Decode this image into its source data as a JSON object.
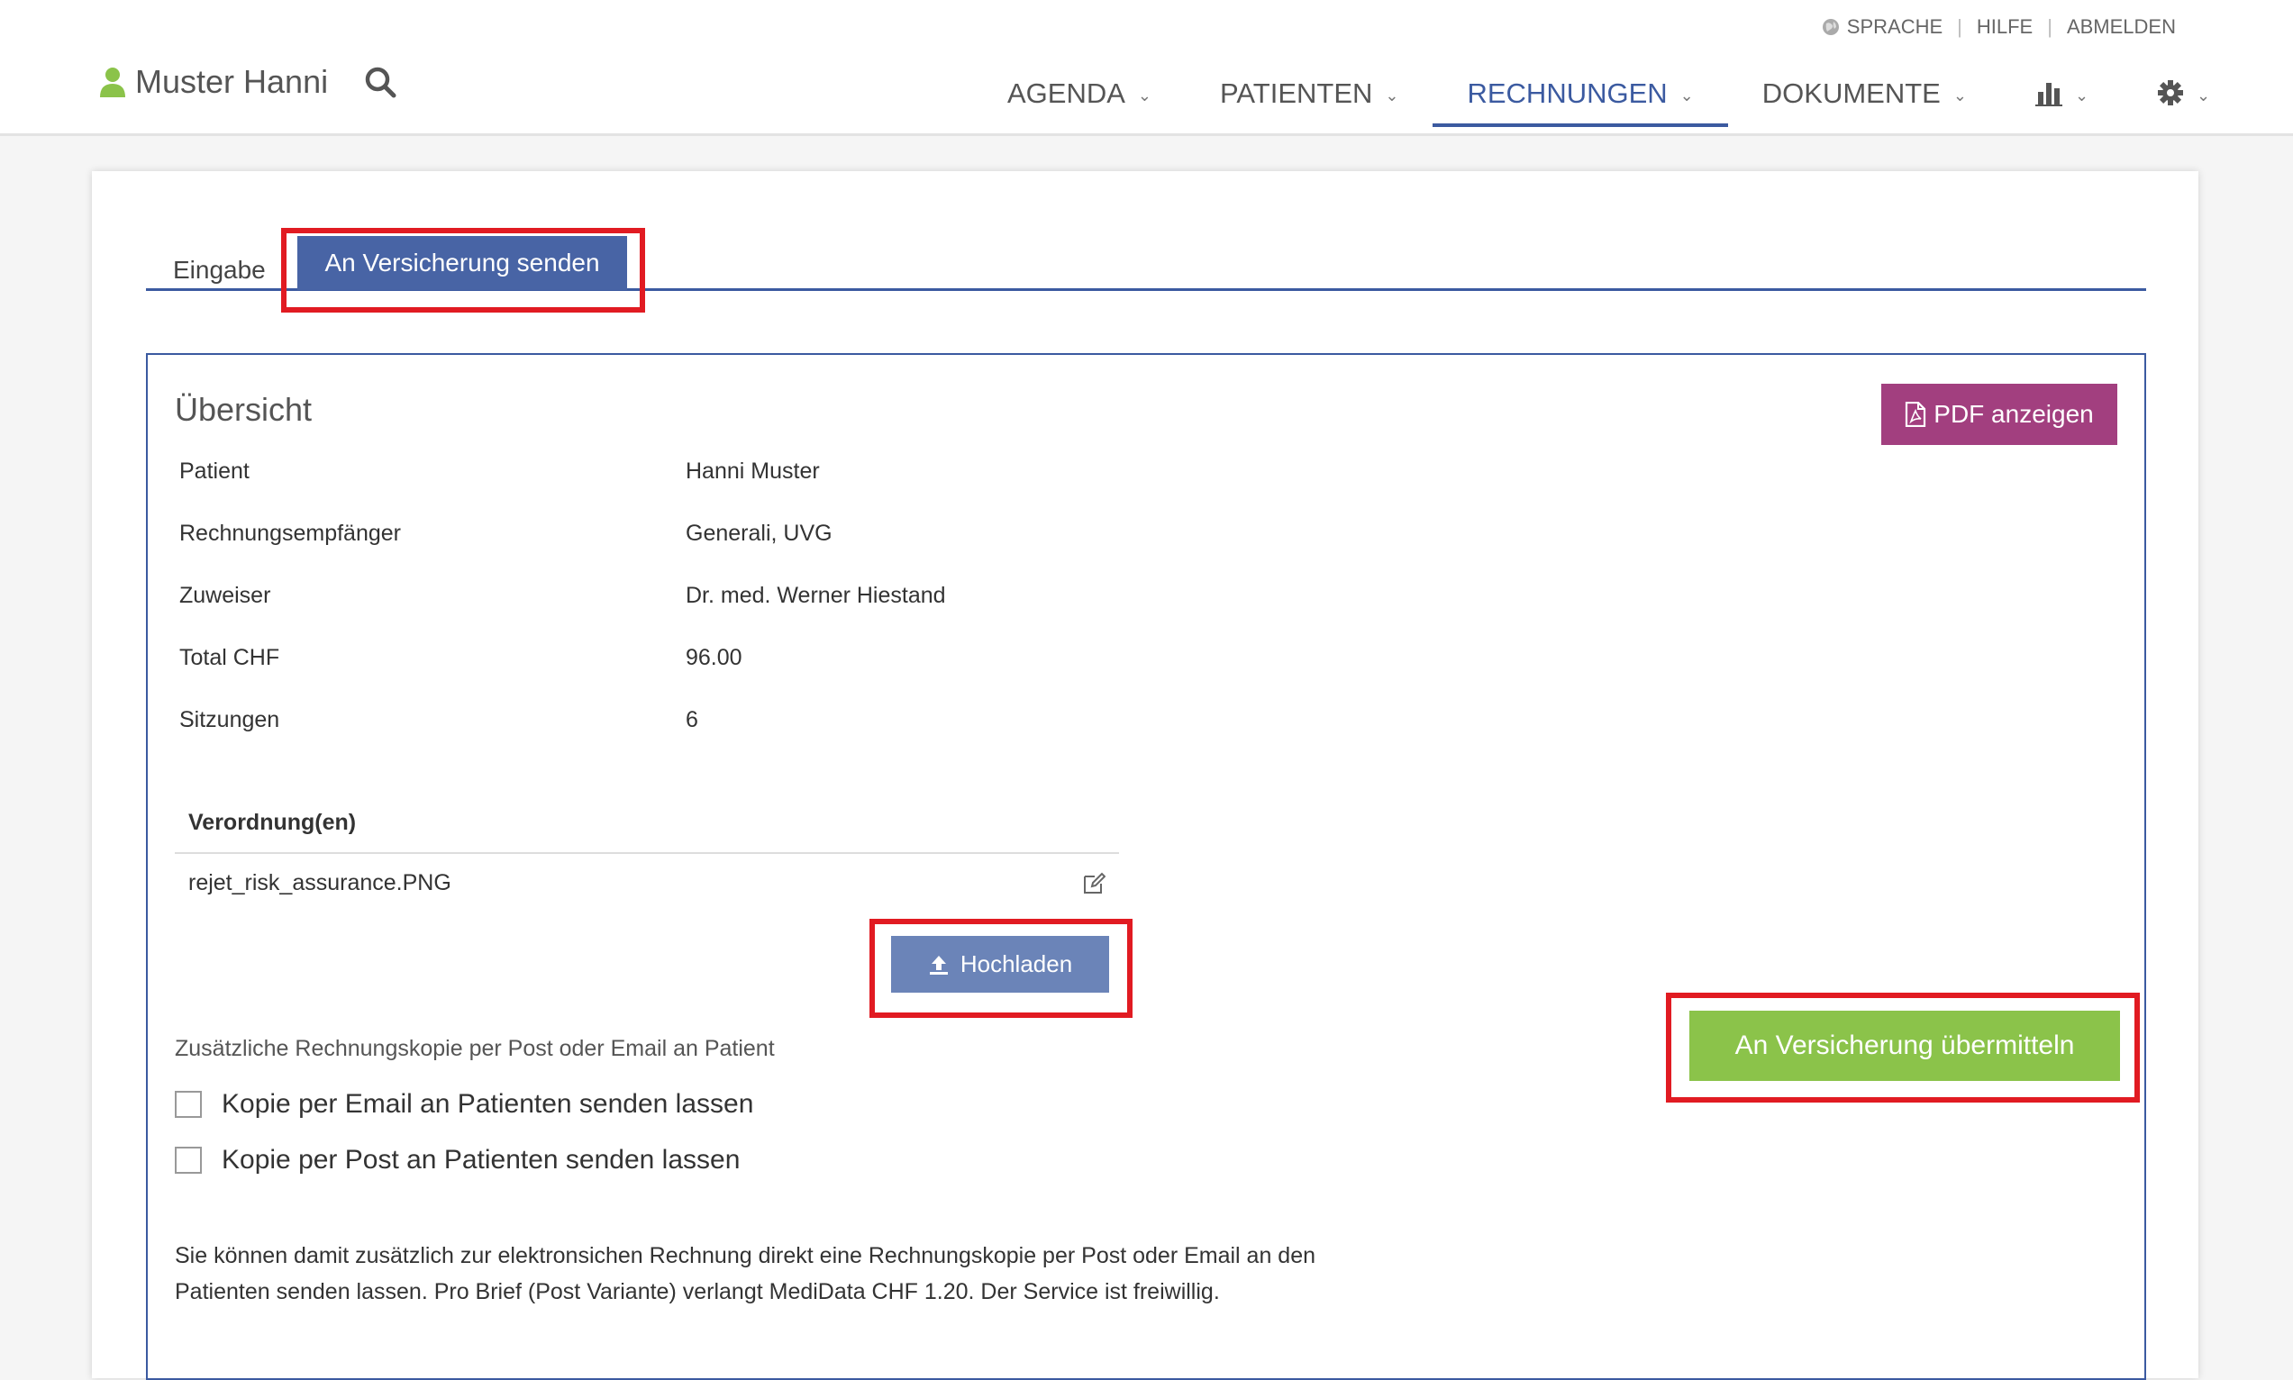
{
  "header": {
    "toplinks": {
      "language": "SPRACHE",
      "help": "HILFE",
      "logout": "ABMELDEN"
    },
    "user_name": "Muster Hanni",
    "nav": [
      {
        "label": "AGENDA"
      },
      {
        "label": "PATIENTEN"
      },
      {
        "label": "RECHNUNGEN",
        "active": true
      },
      {
        "label": "DOKUMENTE"
      }
    ],
    "accent_color": "#3b5aa0"
  },
  "tabs": {
    "entry": "Eingabe",
    "send": "An Versicherung senden"
  },
  "overview": {
    "title": "Übersicht",
    "pdf_button": "PDF anzeigen",
    "rows": [
      {
        "label": "Patient",
        "value": "Hanni Muster"
      },
      {
        "label": "Rechnungsempfänger",
        "value": "Generali, UVG"
      },
      {
        "label": "Zuweiser",
        "value": "Dr. med. Werner Hiestand"
      },
      {
        "label": "Total CHF",
        "value": "96.00"
      },
      {
        "label": "Sitzungen",
        "value": "6"
      }
    ]
  },
  "prescriptions": {
    "heading": "Verordnung(en)",
    "file": "rejet_risk_assurance.PNG",
    "upload_button": "Hochladen"
  },
  "copy_options": {
    "heading": "Zusätzliche Rechnungskopie per Post oder Email an Patient",
    "email_label": "Kopie per Email an Patienten senden lassen",
    "post_label": "Kopie per Post an Patienten senden lassen",
    "info_line1": "Sie können damit zusätzlich zur elektronsichen Rechnung direkt eine Rechnungskopie per Post oder Email an den",
    "info_line2": "Patienten senden lassen. Pro Brief (Post Variante) verlangt MediData CHF 1.20. Der Service ist freiwillig."
  },
  "submit_button": "An Versicherung übermitteln",
  "colors": {
    "pdf": "#a23f7f",
    "upload": "#6b84b8",
    "submit": "#8bc34a",
    "highlight": "#e11b22"
  }
}
